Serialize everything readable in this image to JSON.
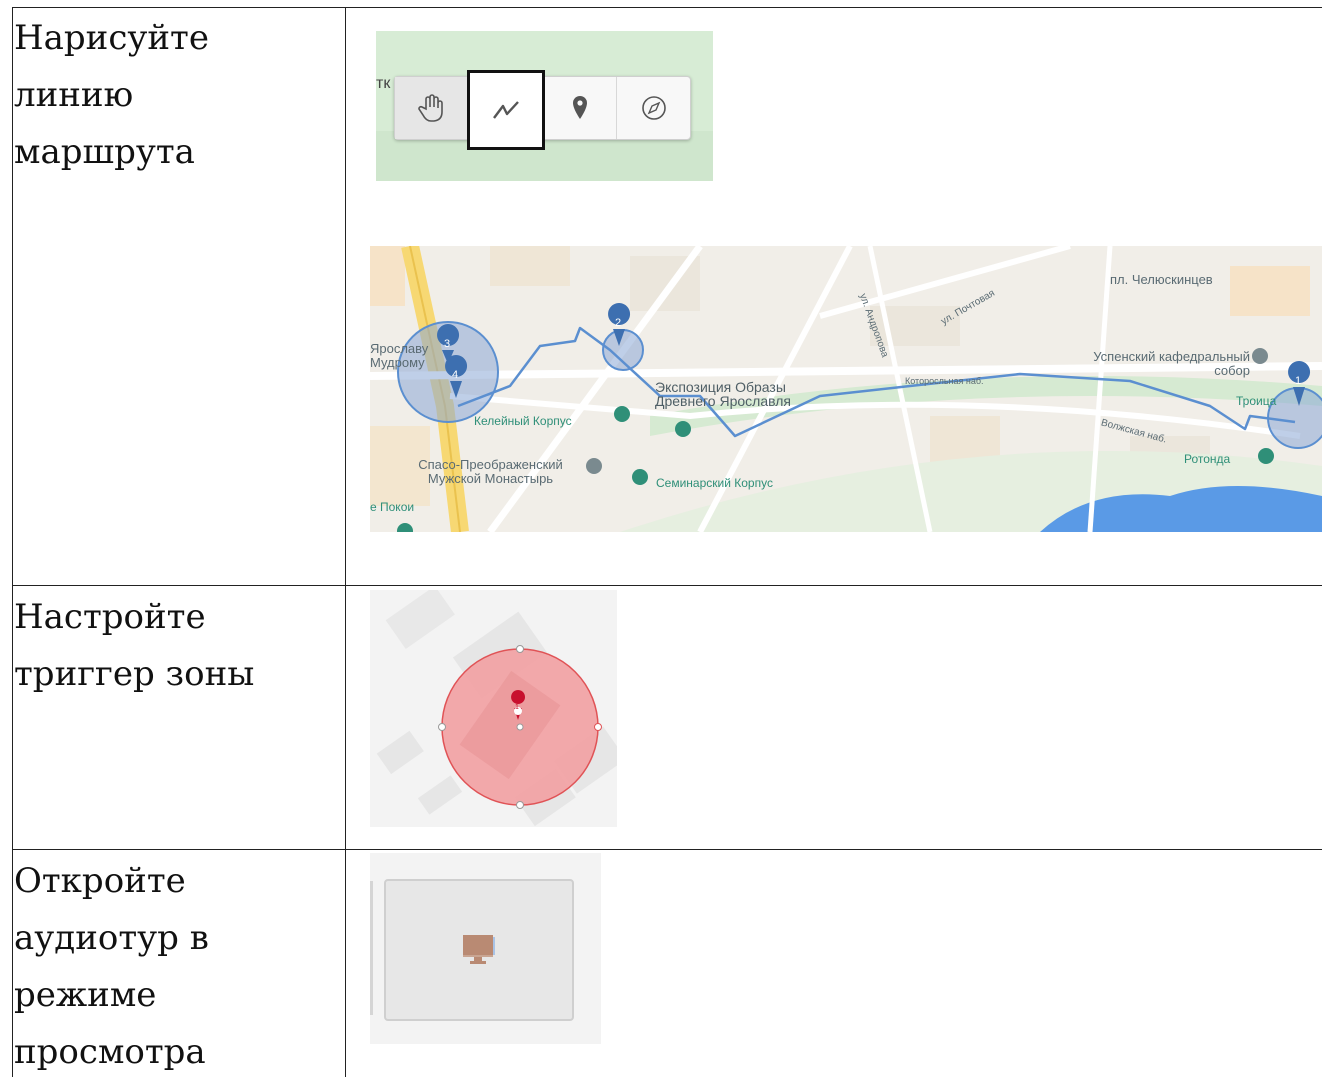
{
  "rows": [
    {
      "lines": [
        "Нарисуйте",
        "линию",
        "маршрута"
      ]
    },
    {
      "lines": [
        "Настройте",
        "триггер зоны"
      ]
    },
    {
      "lines": [
        "Откройте",
        "аудиотур в",
        "режиме",
        "просмотра"
      ]
    }
  ],
  "toolbar_image": {
    "edge_text": "тк",
    "tools": [
      {
        "name": "hand-icon",
        "glyph": "✋"
      },
      {
        "name": "polyline-icon",
        "glyph": "〰"
      },
      {
        "name": "map-pin-icon",
        "glyph": "📍"
      },
      {
        "name": "compass-icon",
        "glyph": "🧭"
      }
    ],
    "selected_tool": "polyline"
  },
  "map_image": {
    "street_labels": [
      "пл. Челюскинцев",
      "ул. Почтовая",
      "ул. Андропова",
      "Волжская наб.",
      "Которосльная наб."
    ],
    "place_labels": [
      "Ярославу Мудрому",
      "Экспозиция Образы Древнего Ярославля",
      "Успенский кафедральный собор",
      "Келейный Корпус",
      "Спасо-Преображенский Мужской Монастырь",
      "Семинарский Корпус",
      "Ротонда",
      "Троица",
      "е Покои"
    ],
    "markers": [
      "1",
      "2",
      "3",
      "4"
    ],
    "colors": {
      "route": "#5b8fd0",
      "zone": "#6d93c9",
      "poi": "#2f8f78"
    }
  },
  "zone_image": {
    "marker": "1",
    "colors": {
      "zone_fill": "#f2a0a2",
      "zone_stroke": "#e05356"
    }
  },
  "preview_image": {
    "icon": "monitor-icon",
    "colors": {
      "monitor": "#b98a73"
    }
  }
}
